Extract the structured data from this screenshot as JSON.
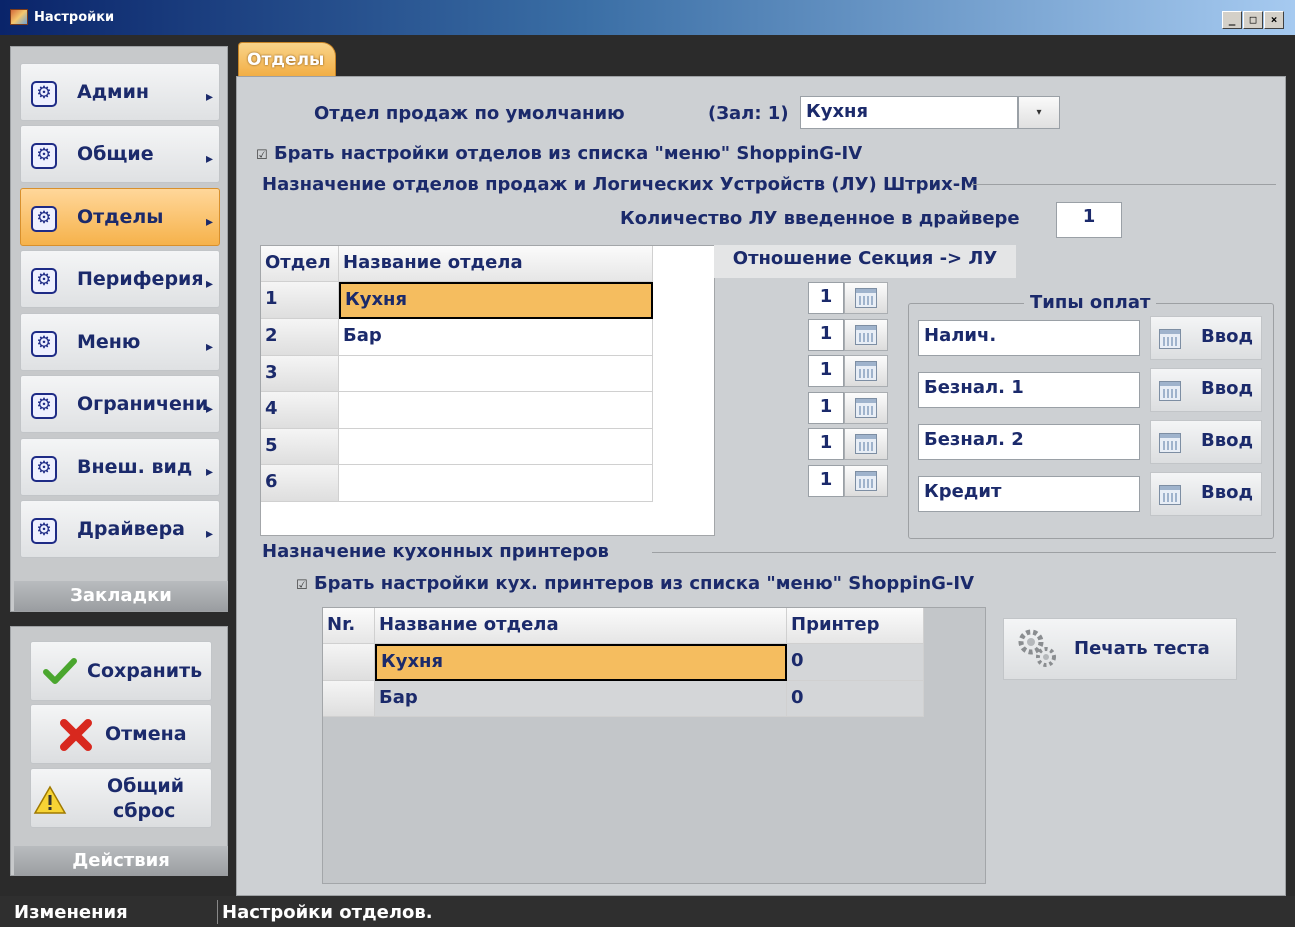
{
  "window": {
    "title": "Настройки",
    "buttons": [
      "_",
      "□",
      "×"
    ]
  },
  "sidebar": {
    "items": [
      {
        "label": "Админ",
        "icon": "gear-icon"
      },
      {
        "label": "Общие",
        "icon": "gear-icon"
      },
      {
        "label": "Отделы",
        "icon": "gear-icon",
        "active": true
      },
      {
        "label": "Периферия",
        "icon": "gear-icon"
      },
      {
        "label": "Меню",
        "icon": "gear-icon"
      },
      {
        "label": "Ограничени",
        "icon": "gear-icon"
      },
      {
        "label": "Внеш. вид",
        "icon": "gear-icon"
      },
      {
        "label": "Драйвера",
        "icon": "gear-icon"
      }
    ],
    "group_label": "Закладки"
  },
  "actions": {
    "save": "Сохранить",
    "cancel": "Отмена",
    "reset_line1": "Общий",
    "reset_line2": "сброс",
    "group_label": "Действия"
  },
  "tab": {
    "label": "Отделы"
  },
  "default_dept": {
    "label": "Отдел продаж по умолчанию",
    "hall": "(Зал: 1)",
    "value": "Кухня"
  },
  "take_settings_from_menu": "Брать настройки отделов из списка \"меню\" ShoppinG-IV",
  "assign_section_title": "Назначение отделов продаж и Логических Устройств (ЛУ) Штрих-М",
  "lu_count": {
    "label": "Количество ЛУ введенное в драйвере",
    "value": "1"
  },
  "dept_table": {
    "headers": [
      "Отдел",
      "Название отдела"
    ],
    "rows": [
      {
        "num": "1",
        "name": "Кухня"
      },
      {
        "num": "2",
        "name": "Бар"
      },
      {
        "num": "3",
        "name": ""
      },
      {
        "num": "4",
        "name": ""
      },
      {
        "num": "5",
        "name": ""
      },
      {
        "num": "6",
        "name": ""
      }
    ]
  },
  "section_lu": {
    "header": "Отношение Секция -> ЛУ",
    "values": [
      "1",
      "1",
      "1",
      "1",
      "1",
      "1"
    ]
  },
  "payment_types": {
    "title": "Типы оплат",
    "items": [
      {
        "name": "Налич.",
        "button": "Ввод"
      },
      {
        "name": "Безнал. 1",
        "button": "Ввод"
      },
      {
        "name": "Безнал. 2",
        "button": "Ввод"
      },
      {
        "name": "Кредит",
        "button": "Ввод"
      }
    ]
  },
  "kitchen_printers": {
    "title": "Назначение кухонных принтеров",
    "checkbox": "Брать настройки кух. принтеров из списка \"меню\" ShoppinG-IV",
    "headers": [
      "Nr.",
      "Название отдела",
      "Принтер"
    ],
    "rows": [
      {
        "nr": "",
        "name": "Кухня",
        "printer": "0"
      },
      {
        "nr": "",
        "name": "Бар",
        "printer": "0"
      }
    ],
    "print_test": "Печать теста"
  },
  "status": {
    "left": "Изменения",
    "right": "Настройки отделов."
  }
}
